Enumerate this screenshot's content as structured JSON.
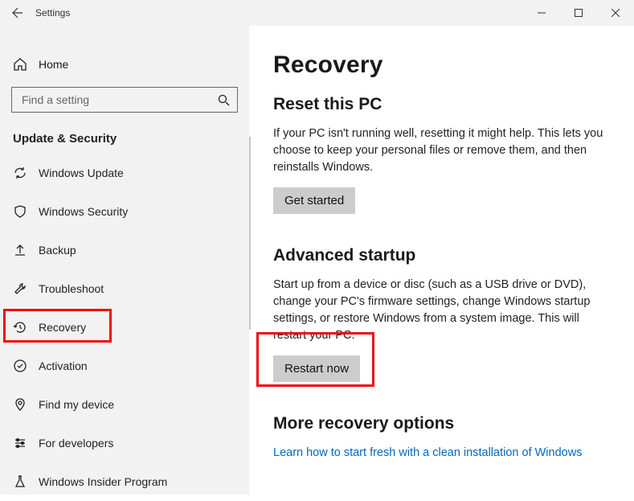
{
  "window": {
    "title": "Settings"
  },
  "home": {
    "label": "Home"
  },
  "search": {
    "placeholder": "Find a setting"
  },
  "section": {
    "label": "Update & Security"
  },
  "nav": {
    "items": [
      {
        "label": "Windows Update"
      },
      {
        "label": "Windows Security"
      },
      {
        "label": "Backup"
      },
      {
        "label": "Troubleshoot"
      },
      {
        "label": "Recovery"
      },
      {
        "label": "Activation"
      },
      {
        "label": "Find my device"
      },
      {
        "label": "For developers"
      },
      {
        "label": "Windows Insider Program"
      }
    ]
  },
  "main": {
    "title": "Recovery",
    "reset": {
      "heading": "Reset this PC",
      "body": "If your PC isn't running well, resetting it might help. This lets you choose to keep your personal files or remove them, and then reinstalls Windows.",
      "button": "Get started"
    },
    "advanced": {
      "heading": "Advanced startup",
      "body": "Start up from a device or disc (such as a USB drive or DVD), change your PC's firmware settings, change Windows startup settings, or restore Windows from a system image. This will restart your PC.",
      "button": "Restart now"
    },
    "more": {
      "heading": "More recovery options",
      "link": "Learn how to start fresh with a clean installation of Windows"
    }
  }
}
